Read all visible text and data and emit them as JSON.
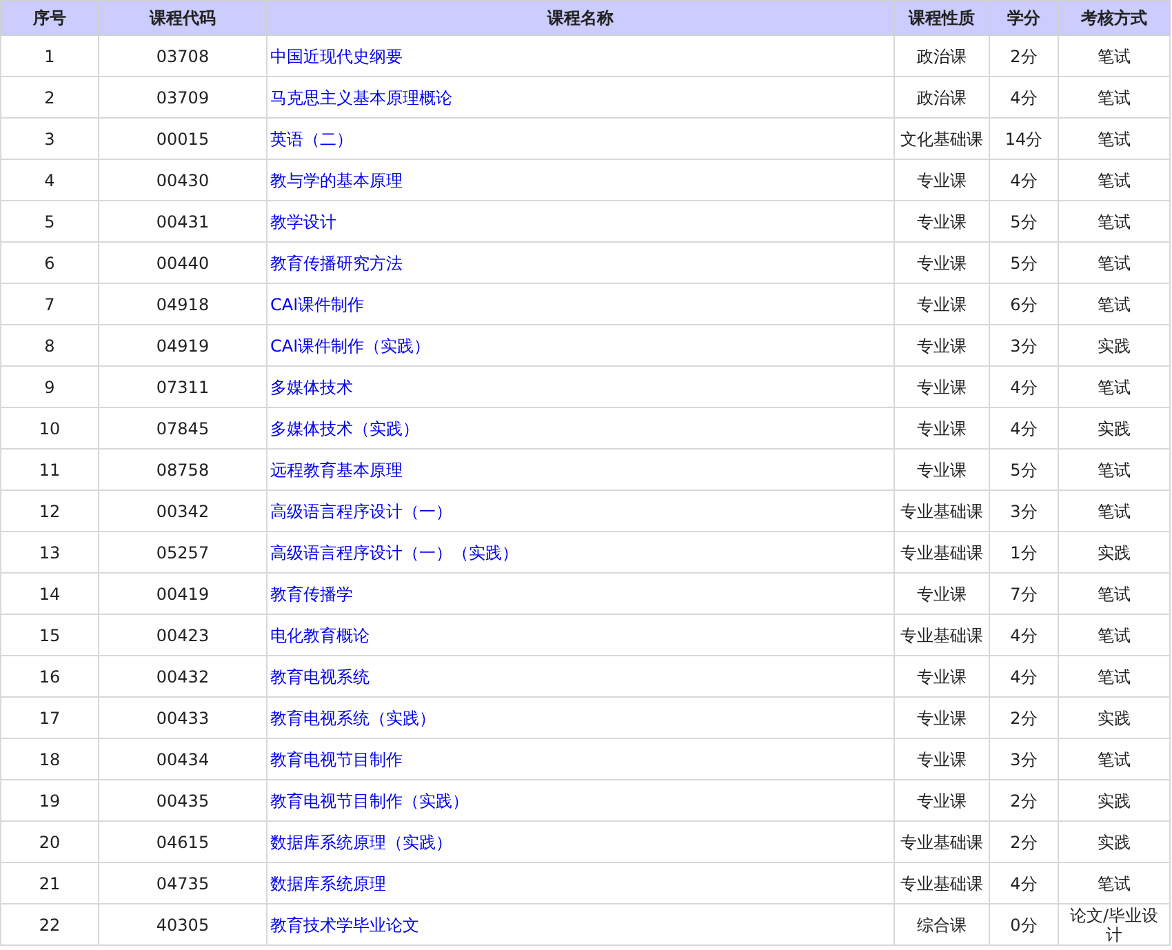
{
  "table": {
    "columns": [
      "序号",
      "课程代码",
      "课程名称",
      "课程性质",
      "学分",
      "考核方式"
    ],
    "rows": [
      {
        "no": "1",
        "code": "03708",
        "name": "中国近现代史纲要",
        "type": "政治课",
        "credits": "2分",
        "exam": "笔试"
      },
      {
        "no": "2",
        "code": "03709",
        "name": "马克思主义基本原理概论",
        "type": "政治课",
        "credits": "4分",
        "exam": "笔试"
      },
      {
        "no": "3",
        "code": "00015",
        "name": "英语（二）",
        "type": "文化基础课",
        "credits": "14分",
        "exam": "笔试"
      },
      {
        "no": "4",
        "code": "00430",
        "name": "教与学的基本原理",
        "type": "专业课",
        "credits": "4分",
        "exam": "笔试"
      },
      {
        "no": "5",
        "code": "00431",
        "name": "教学设计",
        "type": "专业课",
        "credits": "5分",
        "exam": "笔试"
      },
      {
        "no": "6",
        "code": "00440",
        "name": "教育传播研究方法",
        "type": "专业课",
        "credits": "5分",
        "exam": "笔试"
      },
      {
        "no": "7",
        "code": "04918",
        "name": "CAI课件制作",
        "type": "专业课",
        "credits": "6分",
        "exam": "笔试"
      },
      {
        "no": "8",
        "code": "04919",
        "name": "CAI课件制作（实践）",
        "type": "专业课",
        "credits": "3分",
        "exam": "实践"
      },
      {
        "no": "9",
        "code": "07311",
        "name": "多媒体技术",
        "type": "专业课",
        "credits": "4分",
        "exam": "笔试"
      },
      {
        "no": "10",
        "code": "07845",
        "name": "多媒体技术（实践）",
        "type": "专业课",
        "credits": "4分",
        "exam": "实践"
      },
      {
        "no": "11",
        "code": "08758",
        "name": "远程教育基本原理",
        "type": "专业课",
        "credits": "5分",
        "exam": "笔试"
      },
      {
        "no": "12",
        "code": "00342",
        "name": "高级语言程序设计（一）",
        "type": "专业基础课",
        "credits": "3分",
        "exam": "笔试"
      },
      {
        "no": "13",
        "code": "05257",
        "name": "高级语言程序设计（一）（实践）",
        "type": "专业基础课",
        "credits": "1分",
        "exam": "实践"
      },
      {
        "no": "14",
        "code": "00419",
        "name": "教育传播学",
        "type": "专业课",
        "credits": "7分",
        "exam": "笔试"
      },
      {
        "no": "15",
        "code": "00423",
        "name": "电化教育概论",
        "type": "专业基础课",
        "credits": "4分",
        "exam": "笔试"
      },
      {
        "no": "16",
        "code": "00432",
        "name": "教育电视系统",
        "type": "专业课",
        "credits": "4分",
        "exam": "笔试"
      },
      {
        "no": "17",
        "code": "00433",
        "name": "教育电视系统（实践）",
        "type": "专业课",
        "credits": "2分",
        "exam": "实践"
      },
      {
        "no": "18",
        "code": "00434",
        "name": "教育电视节目制作",
        "type": "专业课",
        "credits": "3分",
        "exam": "笔试"
      },
      {
        "no": "19",
        "code": "00435",
        "name": "教育电视节目制作（实践）",
        "type": "专业课",
        "credits": "2分",
        "exam": "实践"
      },
      {
        "no": "20",
        "code": "04615",
        "name": "数据库系统原理（实践）",
        "type": "专业基础课",
        "credits": "2分",
        "exam": "实践"
      },
      {
        "no": "21",
        "code": "04735",
        "name": "数据库系统原理",
        "type": "专业基础课",
        "credits": "4分",
        "exam": "笔试"
      },
      {
        "no": "22",
        "code": "40305",
        "name": "教育技术学毕业论文",
        "type": "综合课",
        "credits": "0分",
        "exam": "论文/毕业设计"
      }
    ]
  }
}
